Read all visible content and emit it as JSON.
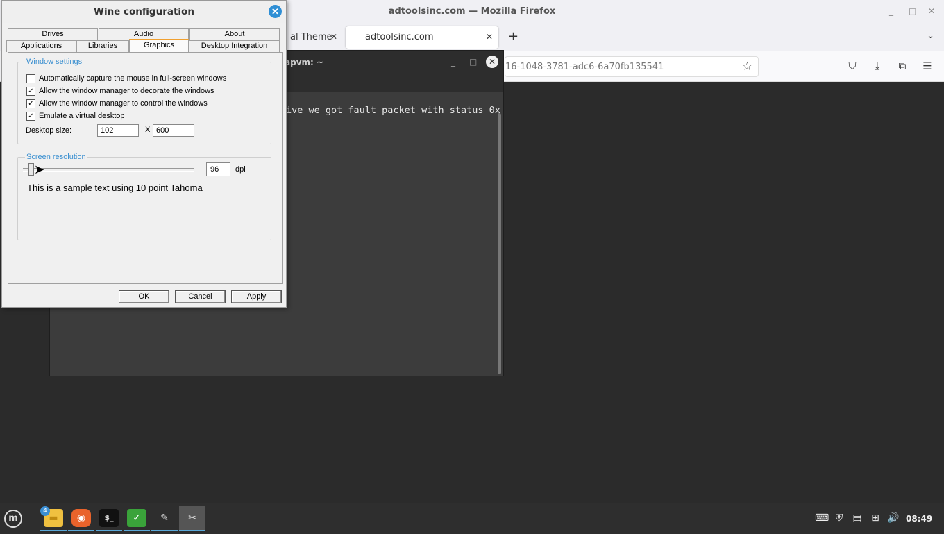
{
  "firefox": {
    "window_title": "adtoolsinc.com — Mozilla Firefox",
    "minimize": "_",
    "maximize": "□",
    "close": "✕",
    "tabs": [
      {
        "label": "al Theme",
        "close": "✕"
      },
      {
        "label": "adtoolsinc.com",
        "close": "✕"
      }
    ],
    "new_tab": "+",
    "tab_list": "⌄",
    "url": "16-1048-3781-adc6-6a70fb135541",
    "star": "☆",
    "toolbar": {
      "pocket": "⛉",
      "downloads": "⤓",
      "extensions": "⧉",
      "menu": "☰"
    }
  },
  "terminal": {
    "title": "apvm: ~",
    "minimize": "_",
    "maximize": "□",
    "close": "✕",
    "output_line": "ive we got fault packet with status 0x"
  },
  "wine": {
    "title": "Wine configuration",
    "close": "✕",
    "tabs_row1": [
      "Drives",
      "Audio",
      "About"
    ],
    "tabs_row2": [
      "Applications",
      "Libraries",
      "Graphics",
      "Desktop Integration"
    ],
    "selected_tab": "Graphics",
    "window_settings": {
      "legend": "Window settings",
      "options": [
        {
          "label": "Automatically capture the mouse in full-screen windows",
          "checked": false
        },
        {
          "label": "Allow the window manager to decorate the windows",
          "checked": true
        },
        {
          "label": "Allow the window manager to control the windows",
          "checked": true
        },
        {
          "label": "Emulate a virtual desktop",
          "checked": true
        }
      ],
      "desktop_size_label": "Desktop size:",
      "width_value": "102",
      "x_label": "X",
      "height_value": "600"
    },
    "screen_resolution": {
      "legend": "Screen resolution",
      "dpi_value": "96",
      "dpi_unit": "dpi",
      "sample_text": "This is a sample text using 10 point Tahoma"
    },
    "buttons": {
      "ok": "OK",
      "cancel": "Cancel",
      "apply": "Apply"
    }
  },
  "taskbar": {
    "menu_icon": "m",
    "apps": [
      {
        "name": "files",
        "glyph": "▬",
        "badge": "4"
      },
      {
        "name": "firefox",
        "glyph": "◉"
      },
      {
        "name": "terminal",
        "glyph": "$_"
      },
      {
        "name": "shield",
        "glyph": "✓"
      },
      {
        "name": "usb",
        "glyph": "✎"
      },
      {
        "name": "wine-config",
        "glyph": "✂"
      }
    ],
    "tray": {
      "keyboard": "⌨",
      "shield": "⛨",
      "clipboard": "▤",
      "network": "⊞",
      "volume": "🔊"
    },
    "clock": "08:49"
  }
}
